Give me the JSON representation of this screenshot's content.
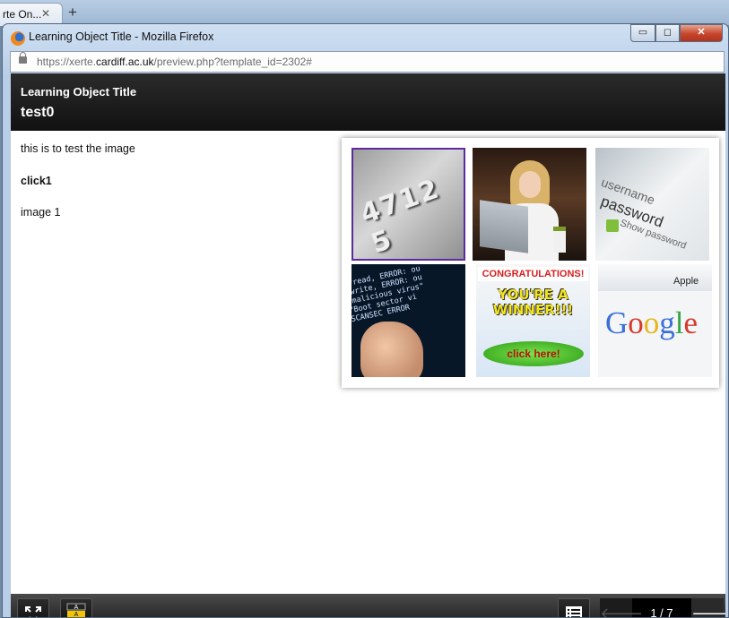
{
  "browser": {
    "tab_title": "rte On...",
    "tab_close": "✕",
    "new_tab": "+"
  },
  "window": {
    "title": "Learning Object Title - Mozilla Firefox",
    "minimize": "▭",
    "maximize": "◻",
    "close": "✕"
  },
  "urlbar": {
    "url_prefix": "https://xerte.",
    "url_domain": "cardiff.ac.uk",
    "url_path": "/preview.php?template_id=2302#"
  },
  "page": {
    "object_title": "Learning Object Title",
    "page_title": "test0",
    "intro": "this is to test the image",
    "click_label": "click1",
    "image_label": "image 1"
  },
  "gallery": {
    "thumbs": [
      {
        "name": "credit-card",
        "text": "4712 5"
      },
      {
        "name": "woman-laptop",
        "text": ""
      },
      {
        "name": "password-screen",
        "lines": [
          "username",
          "password",
          "Show password"
        ]
      },
      {
        "name": "malware-code",
        "code": "_fread, ERROR: ou\n_write, ERROR: ou\n\"malicious virus\"\n\"Boot sector vi\nSCANSEC ERROR"
      },
      {
        "name": "congratulations-ad",
        "lines": [
          "CONGRATULATIONS!",
          "YOU'RE A WINNER!!!",
          "click here!"
        ]
      },
      {
        "name": "google-page",
        "bar": "Apple",
        "logo": "Google"
      }
    ]
  },
  "footer": {
    "counter": "1 / 7",
    "prev": "🡐",
    "next": "🡒"
  },
  "colors": {
    "header_bg": "#1a1a1a",
    "selected_thumb": "#5b2aa0",
    "close_button": "#c6452c"
  }
}
